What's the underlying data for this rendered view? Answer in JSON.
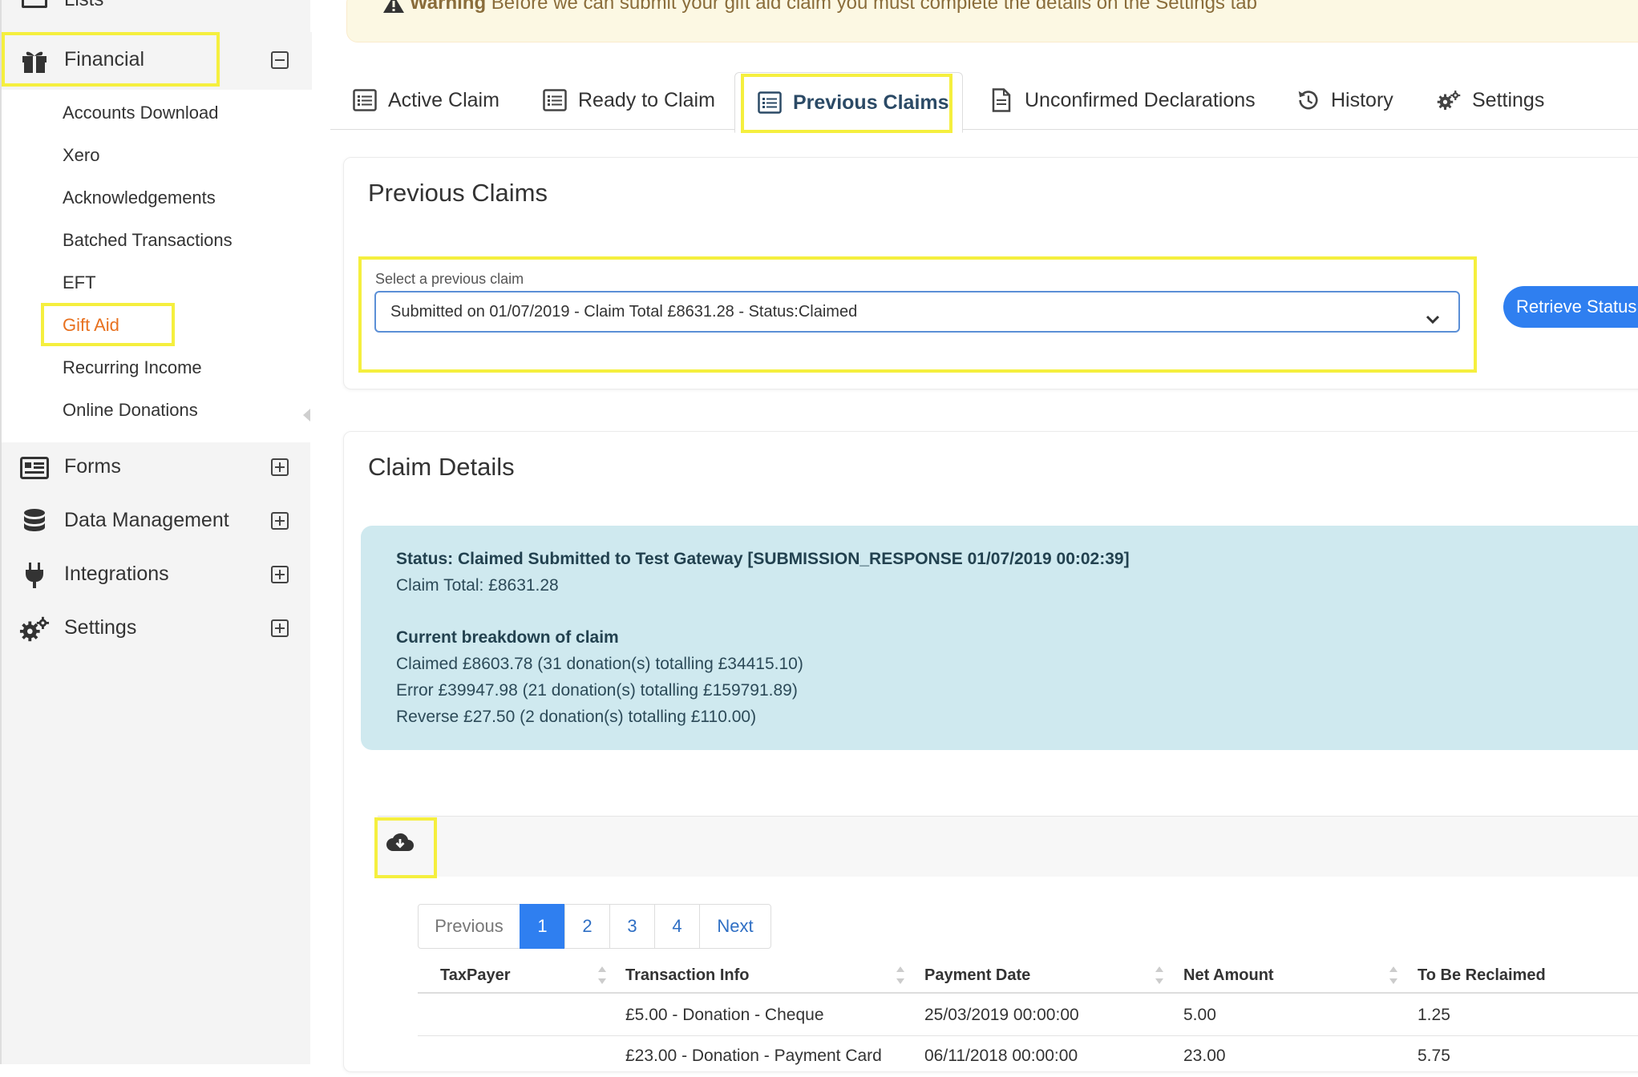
{
  "sidebar": {
    "partial_top_label": "Lists",
    "financial": {
      "label": "Financial",
      "items": [
        {
          "label": "Accounts Download"
        },
        {
          "label": "Xero"
        },
        {
          "label": "Acknowledgements"
        },
        {
          "label": "Batched Transactions"
        },
        {
          "label": "EFT"
        },
        {
          "label": "Gift Aid",
          "active": true
        },
        {
          "label": "Recurring Income"
        },
        {
          "label": "Online Donations"
        }
      ]
    },
    "sections": [
      {
        "label": "Forms",
        "icon": "form-icon"
      },
      {
        "label": "Data Management",
        "icon": "database-icon"
      },
      {
        "label": "Integrations",
        "icon": "plug-icon"
      },
      {
        "label": "Settings",
        "icon": "gears-icon"
      }
    ]
  },
  "warning": {
    "bold": "Warning",
    "text": "Before we can submit your gift aid claim you must complete the details on the Settings tab"
  },
  "tabs": [
    {
      "label": "Active Claim"
    },
    {
      "label": "Ready to Claim"
    },
    {
      "label": "Previous Claims",
      "active": true
    },
    {
      "label": "Unconfirmed Declarations"
    },
    {
      "label": "History"
    },
    {
      "label": "Settings"
    }
  ],
  "previous_claims": {
    "title": "Previous Claims",
    "select_label": "Select a previous claim",
    "selected_value": "Submitted on 01/07/2019 - Claim Total £8631.28 - Status:Claimed",
    "retrieve_button": "Retrieve Status"
  },
  "claim_details": {
    "title": "Claim Details",
    "status_line": "Status: Claimed Submitted to Test Gateway [SUBMISSION_RESPONSE 01/07/2019 00:02:39]",
    "claim_total": "Claim Total: £8631.28",
    "breakdown_title": "Current breakdown of claim",
    "breakdown": [
      "Claimed £8603.78 (31 donation(s) totalling £34415.10)",
      "Error £39947.98 (21 donation(s) totalling £159791.89)",
      "Reverse £27.50 (2 donation(s) totalling £110.00)"
    ]
  },
  "pagination": {
    "previous": "Previous",
    "pages": [
      "1",
      "2",
      "3",
      "4"
    ],
    "current": "1",
    "next": "Next"
  },
  "table": {
    "columns": [
      "TaxPayer",
      "Transaction Info",
      "Payment Date",
      "Net Amount",
      "To Be Reclaimed"
    ],
    "rows": [
      {
        "taxpayer": "",
        "info": "£5.00 - Donation - Cheque",
        "date": "25/03/2019 00:00:00",
        "net": "5.00",
        "reclaim": "1.25"
      },
      {
        "taxpayer": "",
        "info": "£23.00 - Donation - Payment Card",
        "date": "06/11/2018 00:00:00",
        "net": "23.00",
        "reclaim": "5.75"
      }
    ]
  },
  "colors": {
    "accent_blue": "#2f7ff0",
    "active_sidebar_orange": "#e8711f",
    "highlight_yellow": "#f5ef3e",
    "info_box": "#cfe9ef",
    "warning_bg": "#fcf8e3"
  }
}
